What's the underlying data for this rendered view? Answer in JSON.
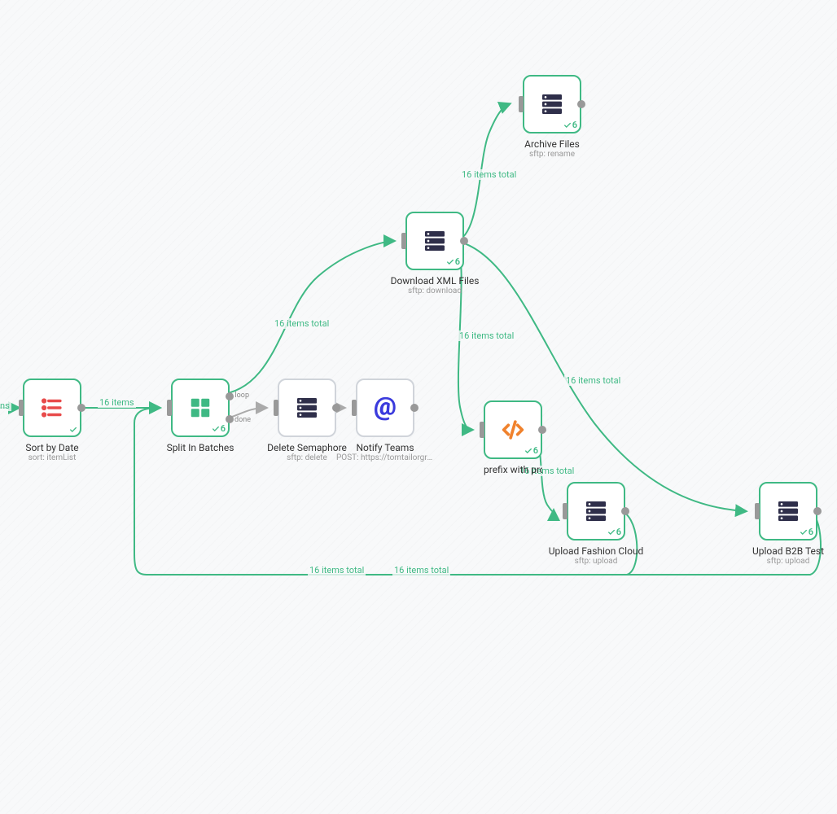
{
  "colors": {
    "success": "#3fb984",
    "icon_dark": "#2f2f4a",
    "icon_orange": "#f0822d",
    "icon_red": "#e84b4b",
    "icon_green": "#3fb984",
    "icon_at": "#3b3bdd"
  },
  "nodes": {
    "sort_by_date": {
      "title": "Sort by Date",
      "sub": "sort: itemList",
      "badge": ""
    },
    "split_batches": {
      "title": "Split In Batches",
      "badge": "6",
      "port_labels": [
        "loop",
        "done"
      ]
    },
    "delete_semaphore": {
      "title": "Delete Semaphore",
      "sub": "sftp: delete",
      "badge": ""
    },
    "notify_teams": {
      "title": "Notify Teams",
      "sub": "POST: https://tomtailorgrou…",
      "badge": ""
    },
    "download_xml": {
      "title": "Download XML Files",
      "sub": "sftp: download",
      "badge": "6"
    },
    "archive_files": {
      "title": "Archive Files",
      "sub": "sftp: rename",
      "badge": "6"
    },
    "prefix_pro": {
      "title": "prefix with pro",
      "badge": "6"
    },
    "upload_fashion": {
      "title": "Upload Fashion Cloud",
      "sub": "sftp: upload",
      "badge": "6"
    },
    "upload_b2b": {
      "title": "Upload B2B Test",
      "sub": "sftp: upload",
      "badge": "6"
    }
  },
  "edges": {
    "e_cut_sort": {
      "label": "ns"
    },
    "e_sort_split": {
      "label": "16 items"
    },
    "e_split_download": {
      "label": "16 items total"
    },
    "e_download_archive": {
      "label": "16 items total"
    },
    "e_download_prefix": {
      "label": "16 items total"
    },
    "e_download_b2b": {
      "label": "16 items total"
    },
    "e_prefix_upload": {
      "label": "16 items total"
    },
    "e_upload_back": {
      "label": "16 items total"
    },
    "e_b2b_back": {
      "label": "16 items total"
    }
  }
}
